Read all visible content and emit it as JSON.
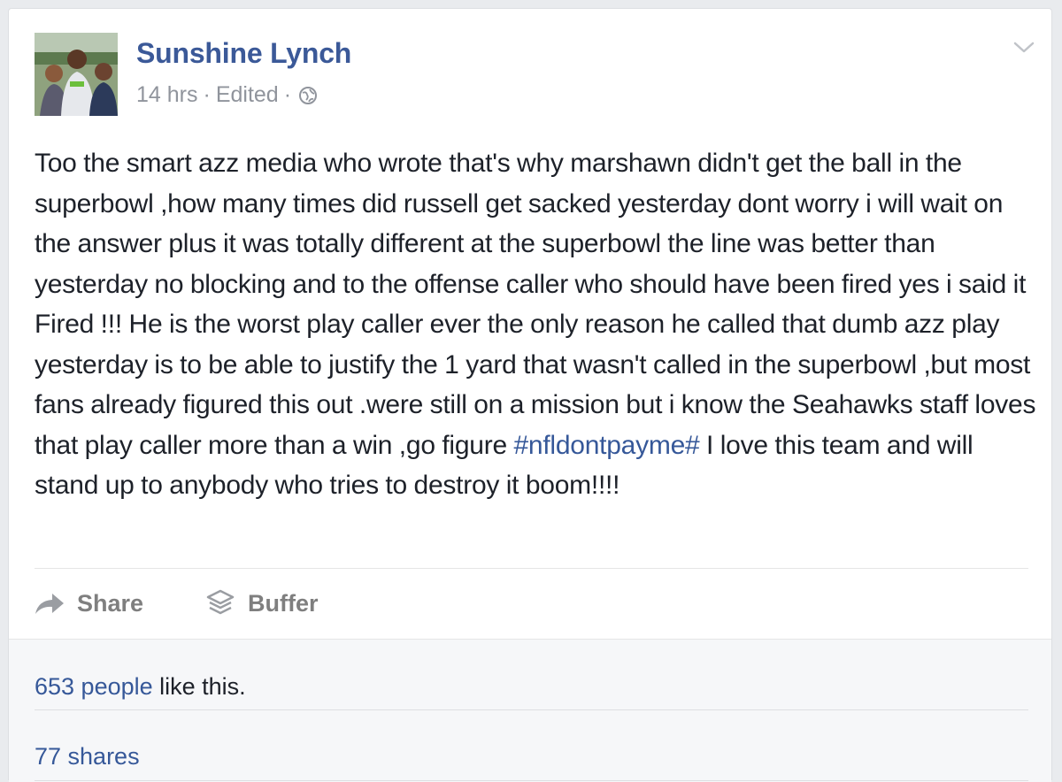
{
  "post": {
    "author": "Sunshine Lynch",
    "time": "14 hrs",
    "edited": "Edited",
    "separator": "·",
    "privacy_icon": "globe-icon",
    "menu_icon": "chevron-down-icon",
    "body_before_hashtag": "Too the smart azz media who wrote that's why marshawn didn't get the ball in the superbowl ,how many times did russell get sacked yesterday dont worry i will wait on the answer plus it was totally different at the superbowl the line was better than yesterday no blocking and to the offense caller who should have been fired yes i said it Fired !!! He is the worst play caller ever the only reason he called that dumb azz play yesterday is to be able to justify the 1 yard that wasn't called in the superbowl ,but most fans already figured this out .were still on a mission but i know the Seahawks staff loves that play caller more than a win ,go figure ",
    "hashtag": "#nfldontpayme#",
    "body_after_hashtag": " I love this team and will stand up to anybody who tries to destroy it boom!!!!"
  },
  "actions": {
    "share_label": "Share",
    "share_icon": "share-arrow-icon",
    "buffer_label": "Buffer",
    "buffer_icon": "buffer-stack-icon"
  },
  "stats": {
    "likes_link": "653 people",
    "likes_suffix": " like this.",
    "shares": "77 shares"
  },
  "colors": {
    "link": "#365899",
    "author": "#3b5998",
    "meta": "#90949c",
    "text": "#1d2129",
    "background": "#e9ebee"
  }
}
